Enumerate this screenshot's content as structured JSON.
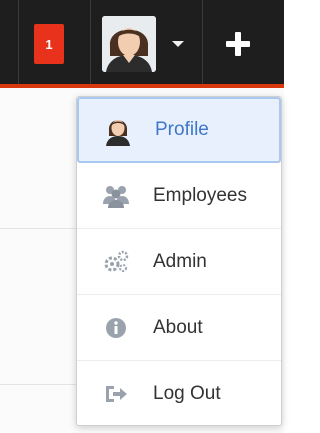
{
  "topbar": {
    "notification_count": "1",
    "accent_color": "#d9380d",
    "background_color": "#1e1e1e"
  },
  "user_menu": {
    "items": [
      {
        "label": "Profile",
        "icon": "person-icon",
        "active": true
      },
      {
        "label": "Employees",
        "icon": "group-icon",
        "active": false
      },
      {
        "label": "Admin",
        "icon": "gears-icon",
        "active": false
      },
      {
        "label": "About",
        "icon": "info-icon",
        "active": false
      },
      {
        "label": "Log Out",
        "icon": "logout-icon",
        "active": false
      }
    ]
  }
}
